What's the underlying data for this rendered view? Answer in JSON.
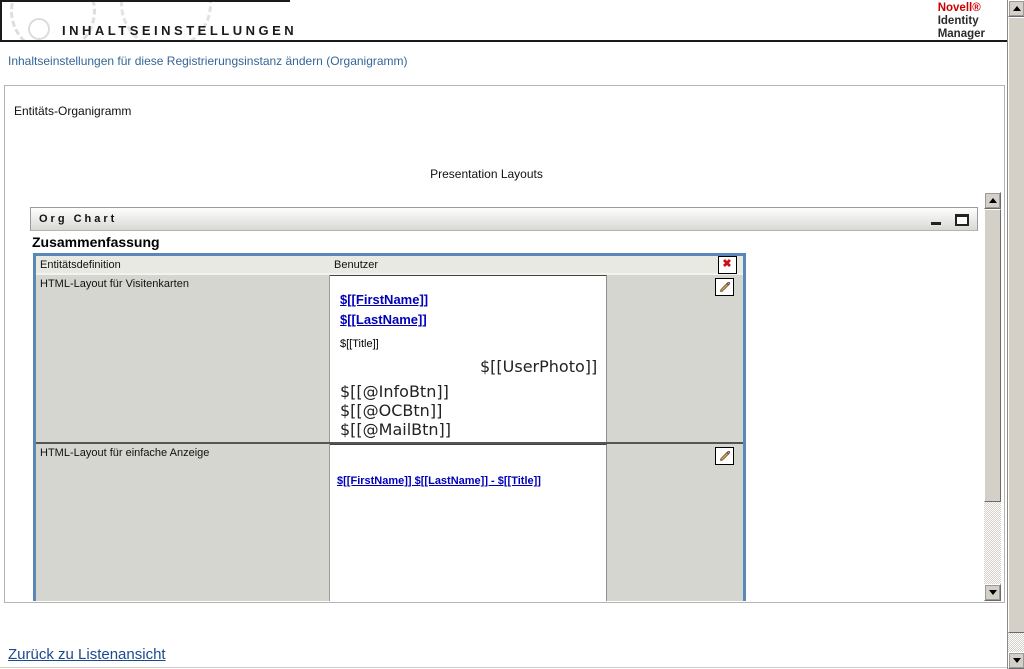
{
  "header": {
    "title": "INHALTSEINSTELLUNGEN",
    "brand": {
      "name": "Novell®",
      "line1": "Identity",
      "line2": "Manager"
    }
  },
  "breadcrumb": "Inhaltseinstellungen für diese Registrierungsinstanz ändern (Organigramm)",
  "panel": {
    "entity_label": "Entitäts-Organigramm",
    "section_title": "Presentation Layouts"
  },
  "org_chart": {
    "window_title": "Org Chart",
    "summary_title": "Zusammenfassung",
    "table": {
      "header_label": "Entitätsdefinition",
      "header_value": "Benutzer",
      "rows": [
        {
          "label": "HTML-Layout für Visitenkarten",
          "card": {
            "links": [
              "$[[FirstName]]",
              "$[[LastName]]"
            ],
            "title_token": "$[[Title]]",
            "photo_token": "$[[UserPhoto]]",
            "buttons": [
              "$[[@InfoBtn]]",
              "$[[@OCBtn]]",
              "$[[@MailBtn]]"
            ]
          }
        },
        {
          "label": "HTML-Layout für einfache Anzeige",
          "layout_text": "$[[FirstName]] $[[LastName]] - $[[Title]]"
        }
      ]
    }
  },
  "icons": {
    "delete": "✖"
  },
  "footer": {
    "back_link": "Zurück zu Listenansicht"
  },
  "colors": {
    "table_border": "#5b87b8",
    "brand_red": "#cc0000",
    "card_link_blue": "#0000bb",
    "breadcrumb_blue": "#336699",
    "footer_link_blue": "#1b4a8f",
    "cell_gray": "#d6d6d0",
    "header_row_gray": "#e9e9e3",
    "scrollbar_face": "#d4d0c8"
  }
}
